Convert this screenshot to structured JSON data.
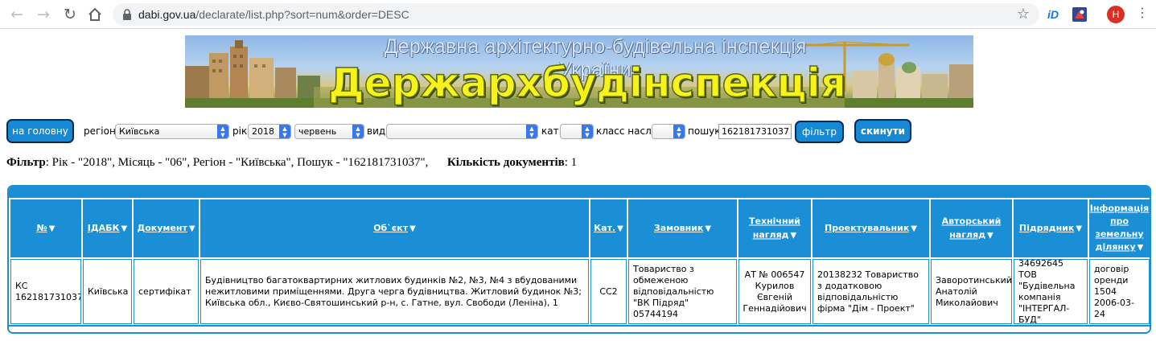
{
  "browser": {
    "url_host": "dabi.gov.ua",
    "url_path": "/declarate/list.php?sort=num&order=DESC",
    "ext_id_label": "iD",
    "avatar_letter": "H"
  },
  "banner": {
    "subtitle": "Державна архітектурно-будівельна інспекція України",
    "title": "Держархбудінспекція України"
  },
  "filters": {
    "home_button": "на головну",
    "region_label": "регіон",
    "region_value": "Київська",
    "year_label": "рік",
    "year_value": "2018",
    "month_value": "червень",
    "type_label": "вид",
    "type_value": "",
    "cat_label": "кат.",
    "cat_value": "",
    "class_label": "класс насл.",
    "class_value": "",
    "search_label": "пошук",
    "search_value": "162181731037",
    "filter_button": "фільтр",
    "reset_button": "скинути"
  },
  "summary": {
    "filter_label": "Фільтр",
    "filter_text": ": Рік - \"2018\", Місяць - \"06\", Регіон - \"Київська\", Пошук - \"162181731037\",",
    "count_label": "Кількість документів",
    "count_text": ": 1"
  },
  "table": {
    "headers": [
      [
        "№"
      ],
      [
        "ІДАБК"
      ],
      [
        "Документ"
      ],
      [
        "Об`єкт"
      ],
      [
        "Кат."
      ],
      [
        "Замовник"
      ],
      [
        "Технічний",
        "нагляд"
      ],
      [
        "Проектувальник"
      ],
      [
        "Авторський",
        "нагляд"
      ],
      [
        "Підрядник"
      ],
      [
        "Інформація",
        "про",
        "земельну",
        "ділянку"
      ]
    ],
    "row": {
      "num": "КС 162181731037",
      "idabk": "Київська",
      "document": "сертифікат",
      "object": "Будівництво багатоквартирних житлових будинків №2, №3, №4 з вбудованими нежитловими приміщеннями. Друга черга будівництва. Житловий будинок №3; Київська обл., Києво-Святошинський р-н, с. Гатне, вул. Свободи (Леніна), 1",
      "category": "СС2",
      "customer": "Товариство з обмеженою відповідальністю \"ВК Підряд\" 05744194",
      "tech_supervision": "АТ № 006547 Курилов Євгеній Геннадійович",
      "designer": "20138232 Товариство з додатковою відповідальністю фірма \"Дім - Проект\"",
      "author_supervision": "Заворотинський Анатолій Миколайович",
      "contractor": "34692645 ТОВ \"Будівельна компанія \"ІНТЕРГАЛ-БУД\"",
      "land_info": "договір оренди 1504 2006-03-24"
    }
  },
  "colors": {
    "table_blue": "#1a8fd6",
    "button_blue": "#1788d4",
    "banner_title": "#f6f21a"
  }
}
